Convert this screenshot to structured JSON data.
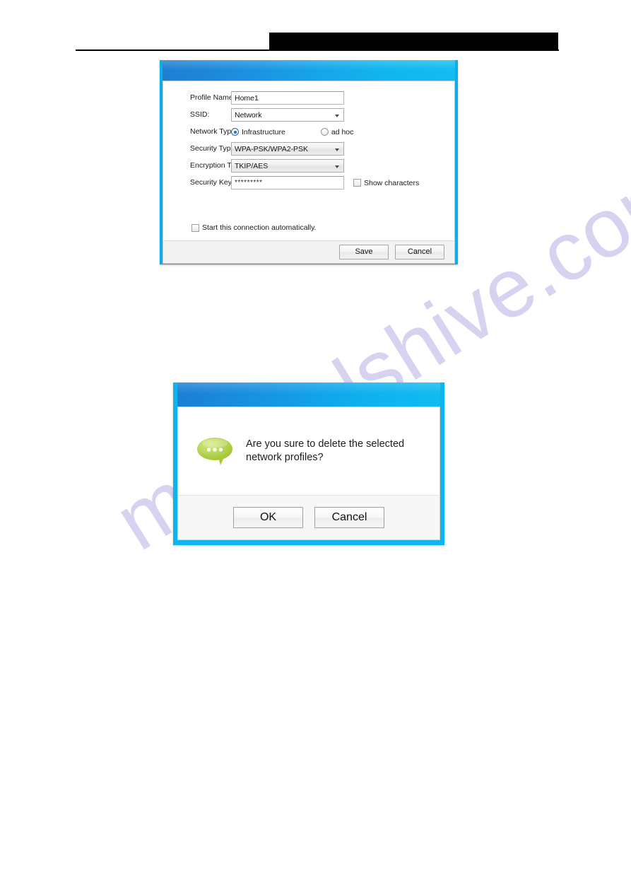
{
  "watermark": {
    "text": "manualshive.com"
  },
  "header": {
    "redaction_bar": "",
    "rule": ""
  },
  "profile_dialog": {
    "title": "",
    "fields": {
      "profile_name": {
        "label": "Profile Name:",
        "value": "Home1",
        "placeholder": ""
      },
      "ssid": {
        "label": "SSID:",
        "value": "Network"
      },
      "network_type": {
        "label": "Network Type:",
        "options": [
          {
            "label": "Infrastructure",
            "selected": true
          },
          {
            "label": "ad hoc",
            "selected": false
          }
        ]
      },
      "security_type": {
        "label": "Security Type:",
        "value": "WPA-PSK/WPA2-PSK"
      },
      "encryption_type": {
        "label": "Encryption Type:",
        "value": "TKIP/AES"
      },
      "security_key": {
        "label": "Security Key:",
        "value": "*********",
        "show_characters_label": "Show characters",
        "show_characters_checked": false
      }
    },
    "auto_start": {
      "label": "Start this connection automatically.",
      "checked": false
    },
    "buttons": {
      "save": "Save",
      "cancel": "Cancel"
    }
  },
  "confirm_dialog": {
    "title": "",
    "icon": "speech-bubble-icon",
    "message": "Are you sure to delete the selected network profiles?",
    "buttons": {
      "ok": "OK",
      "cancel": "Cancel"
    }
  },
  "colors": {
    "dialog_frame": "#0aaee8",
    "titlebar_start": "#1f7fd0",
    "titlebar_end": "#12bdf2",
    "icon_green": "#a6ce39",
    "watermark": "#d5d3f0",
    "radio_selected": "#1f6ebd"
  }
}
